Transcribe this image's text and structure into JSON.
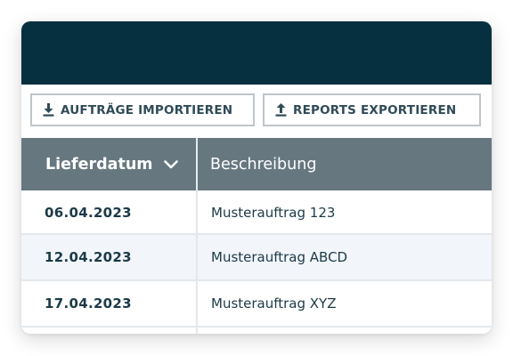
{
  "toolbar": {
    "import_label": "AUFTRÄGE IMPORTIEREN",
    "import_icon": "download-icon",
    "export_label": "REPORTS EXPORTIEREN",
    "export_icon": "upload-icon"
  },
  "table": {
    "columns": [
      {
        "label": "Lieferdatum",
        "sorted": "descending",
        "sort_icon": "chevron-down-icon"
      },
      {
        "label": "Beschreibung"
      }
    ],
    "rows": [
      {
        "date": "06.04.2023",
        "description": "Musterauftrag 123"
      },
      {
        "date": "12.04.2023",
        "description": "Musterauftrag ABCD"
      },
      {
        "date": "17.04.2023",
        "description": "Musterauftrag XYZ"
      }
    ]
  },
  "colors": {
    "header_bar": "#06303f",
    "table_header": "#667780",
    "text_dark": "#1c3a48",
    "row_alt": "#f2f6fb"
  }
}
